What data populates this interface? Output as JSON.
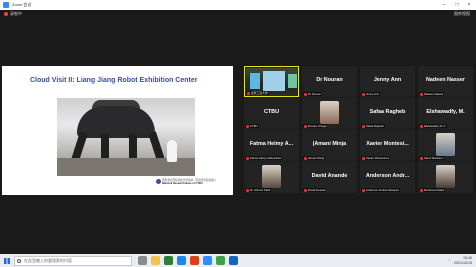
{
  "window": {
    "title": "Zoom 会议"
  },
  "recording": {
    "label": "录制中"
  },
  "view": {
    "label": "图库视图"
  },
  "share": {
    "slide_title": "Cloud Visit II: Liang Jiang Robot Exhibition Center",
    "logo_cn": "国家重庆国际科技合作基地 · 西南研究院机器人",
    "logo_en": "National Research Base of CTBU"
  },
  "participants": [
    {
      "tile_name": "",
      "label": "重庆工商大学",
      "type": "video"
    },
    {
      "tile_name": "Dr Nouran",
      "label": "Dr Nouran",
      "type": "name"
    },
    {
      "tile_name": "Jenny Ann",
      "label": "Jenny Ann",
      "type": "name"
    },
    {
      "tile_name": "Nadeen Nasser",
      "label": "Nadeen Nasser",
      "type": "name"
    },
    {
      "tile_name": "CTBU",
      "label": "CTBU",
      "type": "name"
    },
    {
      "tile_name": "",
      "label": "Renato Ortega",
      "type": "avatar",
      "color": "#8a6a55"
    },
    {
      "tile_name": "Safaa Ragheb",
      "label": "Safaa Ragheb",
      "type": "name"
    },
    {
      "tile_name": "Elshawadfy, M.",
      "label": "Elshawadfy, M. A.",
      "type": "name"
    },
    {
      "tile_name": "Fatma Helmy A...",
      "label": "Fatma Helmy Abdelzaher",
      "type": "name"
    },
    {
      "tile_name": "|Amani Minja",
      "label": "|Amani Minja",
      "type": "name"
    },
    {
      "tile_name": "Xavier Montesi...",
      "label": "Xavier Montesinos",
      "type": "name"
    },
    {
      "tile_name": "",
      "label": "Samir Eisasser",
      "type": "avatar",
      "color": "#6b7a8c"
    },
    {
      "tile_name": "",
      "label": "Dr. Ahmed Saidi",
      "type": "avatar",
      "color": "#5a4a3e"
    },
    {
      "tile_name": "David Anande",
      "label": "David Anande",
      "type": "name"
    },
    {
      "tile_name": "Anderson Andr...",
      "label": "Anderson Andres Mosquer",
      "type": "name"
    },
    {
      "tile_name": "",
      "label": "Mohamed Saad",
      "type": "avatar",
      "color": "#4b3b33"
    }
  ],
  "taskbar": {
    "search_placeholder": "在这里输入你要搜索的内容",
    "time": "15:40",
    "date": "2021/10/15"
  },
  "colors": {
    "speaking_border": "#e9e41a",
    "slide_title": "#3b4ea0"
  }
}
